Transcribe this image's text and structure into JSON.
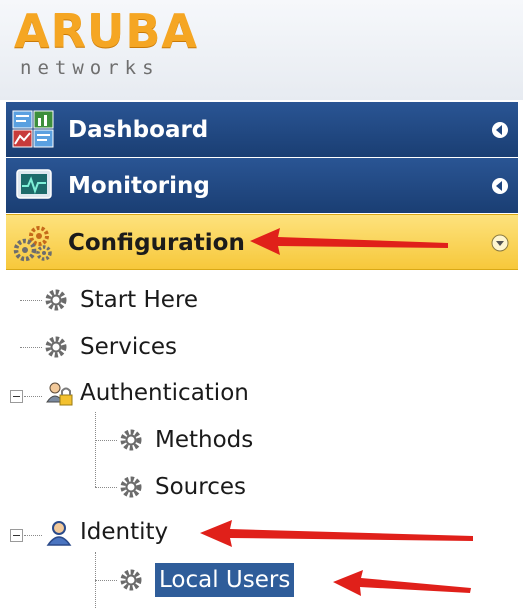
{
  "brand": {
    "logo_text": "ARUBA",
    "sub_text": "networks"
  },
  "nav": {
    "items": [
      {
        "label": "Dashboard",
        "icon": "dashboard-icon",
        "state": "collapsed"
      },
      {
        "label": "Monitoring",
        "icon": "monitoring-icon",
        "state": "collapsed"
      },
      {
        "label": "Configuration",
        "icon": "configuration-gears-icon",
        "state": "expanded"
      }
    ]
  },
  "tree": {
    "start_here": "Start Here",
    "services": "Services",
    "authentication": "Authentication",
    "methods": "Methods",
    "sources": "Sources",
    "identity": "Identity",
    "local_users": "Local Users"
  },
  "colors": {
    "nav_dark": "#1f4680",
    "nav_active": "#f9d04e",
    "selection": "#2f5d9a",
    "annotation_arrow": "#e0201a",
    "brand_orange": "#f5a623"
  }
}
